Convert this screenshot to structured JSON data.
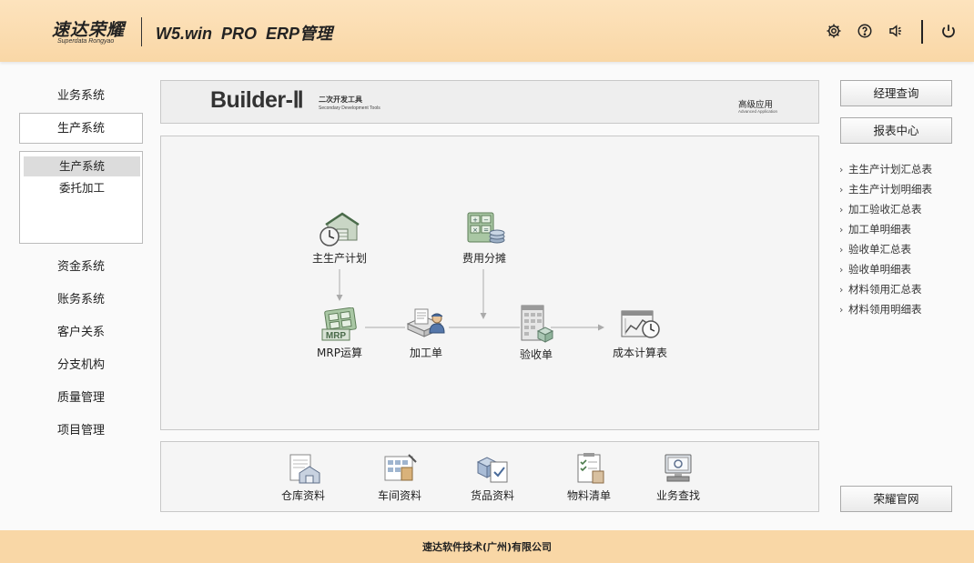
{
  "header": {
    "logo_cn": "速达荣耀",
    "logo_en": "Superdata Rongyao",
    "app_title": "W5.win  PRO  ERP管理",
    "icons": [
      "gear-icon",
      "help-icon",
      "speaker-icon",
      "power-icon"
    ]
  },
  "sidebar": {
    "items_top": [
      {
        "label": "业务系统"
      },
      {
        "label": "生产系统"
      }
    ],
    "sub_items": [
      {
        "label": "生产系统"
      },
      {
        "label": "委托加工"
      }
    ],
    "items_bottom": [
      {
        "label": "资金系统"
      },
      {
        "label": "账务系统"
      },
      {
        "label": "客户关系"
      },
      {
        "label": "分支机构"
      },
      {
        "label": "质量管理"
      },
      {
        "label": "项目管理"
      }
    ]
  },
  "banner": {
    "title": "Builder-Ⅱ",
    "subtitle_cn": "二次开发工具",
    "subtitle_en": "Secondary Development Tools",
    "adv_cn": "高级应用",
    "adv_en": "Advanced Application"
  },
  "flow": {
    "nodes": [
      {
        "label": "主生产计划",
        "icon": "warehouse-clock-icon"
      },
      {
        "label": "费用分摊",
        "icon": "calculator-coins-icon"
      },
      {
        "label": "MRP运算",
        "icon": "mrp-calculator-icon"
      },
      {
        "label": "加工单",
        "icon": "worker-document-icon"
      },
      {
        "label": "验收单",
        "icon": "building-box-icon"
      },
      {
        "label": "成本计算表",
        "icon": "chart-clock-icon"
      }
    ]
  },
  "tools": [
    {
      "label": "仓库资料",
      "icon": "warehouse-doc-icon"
    },
    {
      "label": "车间资料",
      "icon": "workshop-doc-icon"
    },
    {
      "label": "货品资料",
      "icon": "goods-check-icon"
    },
    {
      "label": "物料清单",
      "icon": "checklist-icon"
    },
    {
      "label": "业务查找",
      "icon": "monitor-search-icon"
    }
  ],
  "right": {
    "btn_manager": "经理查询",
    "btn_report": "报表中心",
    "links": [
      {
        "label": "主生产计划汇总表"
      },
      {
        "label": "主生产计划明细表"
      },
      {
        "label": "加工验收汇总表"
      },
      {
        "label": "加工单明细表"
      },
      {
        "label": "验收单汇总表"
      },
      {
        "label": "验收单明细表"
      },
      {
        "label": "材料领用汇总表"
      },
      {
        "label": "材料领用明细表"
      }
    ],
    "btn_site": "荣耀官网"
  },
  "footer": {
    "text": "速达软件技术(广州)有限公司"
  }
}
